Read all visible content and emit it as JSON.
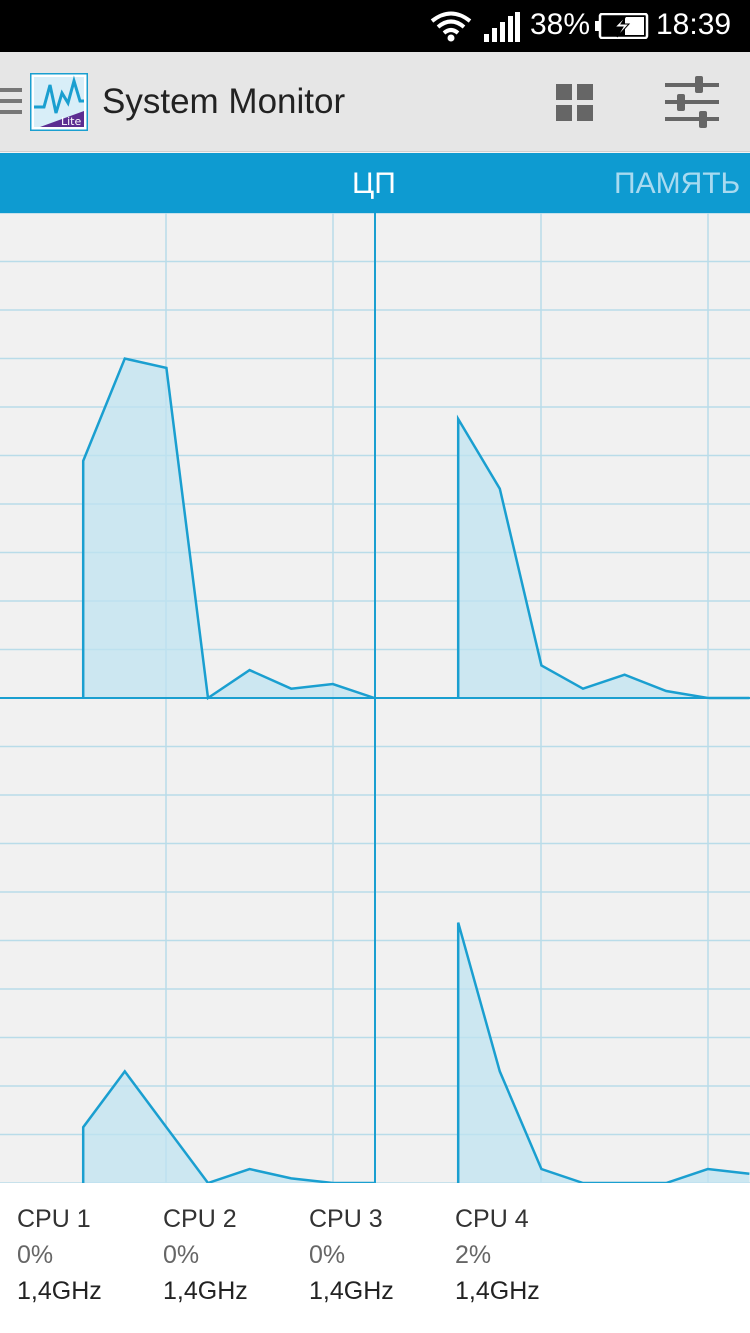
{
  "status_bar": {
    "battery_percent": "38%",
    "time": "18:39",
    "icons": [
      "wifi-icon",
      "signal-icon",
      "battery-charging-icon"
    ]
  },
  "action_bar": {
    "title": "System Monitor",
    "app_icon_badge": "Lite",
    "icons": [
      "menu-icon",
      "app-icon",
      "grid-view-icon",
      "settings-sliders-icon"
    ]
  },
  "tabs": [
    {
      "label": "ЦП",
      "active": true
    },
    {
      "label": "ПАМЯТЬ",
      "active": false
    }
  ],
  "colors": {
    "accent": "#0e9bd1",
    "line": "#1a9fd0",
    "fill": "#bfe3f0"
  },
  "chart_data": [
    {
      "type": "area",
      "name": "CPU 1",
      "ylim": [
        0,
        100
      ],
      "values": [
        null,
        null,
        51,
        73,
        71,
        0,
        6,
        2,
        3,
        0
      ]
    },
    {
      "type": "area",
      "name": "CPU 2",
      "ylim": [
        0,
        100
      ],
      "values": [
        null,
        null,
        60,
        45,
        7,
        2,
        5,
        1.5,
        0,
        0
      ]
    },
    {
      "type": "area",
      "name": "CPU 3",
      "ylim": [
        0,
        100
      ],
      "values": [
        null,
        null,
        12,
        24,
        12,
        0,
        3,
        1,
        0,
        0
      ]
    },
    {
      "type": "area",
      "name": "CPU 4",
      "ylim": [
        0,
        100
      ],
      "values": [
        null,
        null,
        56,
        24,
        3,
        0,
        0,
        0,
        3,
        2
      ]
    }
  ],
  "cpus": [
    {
      "name": "CPU 1",
      "load": "0%",
      "freq": "1,4GHz"
    },
    {
      "name": "CPU 2",
      "load": "0%",
      "freq": "1,4GHz"
    },
    {
      "name": "CPU 3",
      "load": "0%",
      "freq": "1,4GHz"
    },
    {
      "name": "CPU 4",
      "load": "2%",
      "freq": "1,4GHz"
    }
  ]
}
